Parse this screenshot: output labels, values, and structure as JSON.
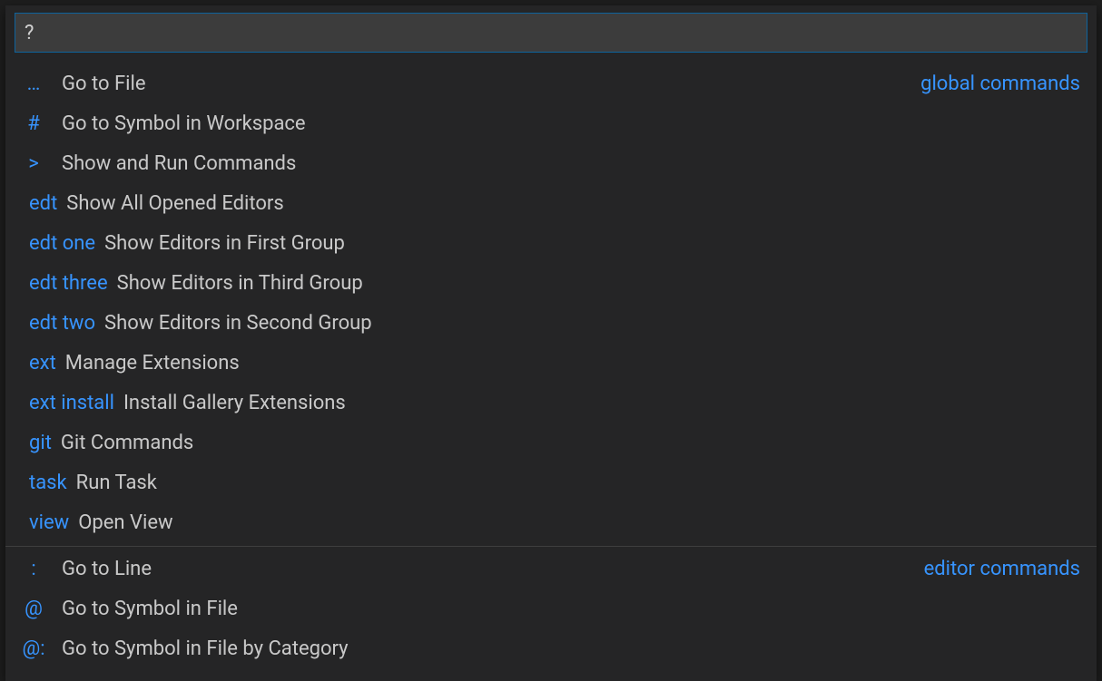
{
  "input": {
    "value": "?",
    "placeholder": ""
  },
  "groups": [
    {
      "badge": "global commands",
      "items": [
        {
          "prefix": "…",
          "short": true,
          "label": "Go to File"
        },
        {
          "prefix": "#",
          "short": true,
          "label": "Go to Symbol in Workspace"
        },
        {
          "prefix": ">",
          "short": true,
          "label": "Show and Run Commands"
        },
        {
          "prefix": "edt",
          "short": false,
          "label": "Show All Opened Editors"
        },
        {
          "prefix": "edt one",
          "short": false,
          "label": "Show Editors in First Group"
        },
        {
          "prefix": "edt three",
          "short": false,
          "label": "Show Editors in Third Group"
        },
        {
          "prefix": "edt two",
          "short": false,
          "label": "Show Editors in Second Group"
        },
        {
          "prefix": "ext",
          "short": false,
          "label": "Manage Extensions"
        },
        {
          "prefix": "ext install",
          "short": false,
          "label": "Install Gallery Extensions"
        },
        {
          "prefix": "git",
          "short": false,
          "label": "Git Commands"
        },
        {
          "prefix": "task",
          "short": false,
          "label": "Run Task"
        },
        {
          "prefix": "view",
          "short": false,
          "label": "Open View"
        }
      ]
    },
    {
      "badge": "editor commands",
      "items": [
        {
          "prefix": ":",
          "short": true,
          "label": "Go to Line"
        },
        {
          "prefix": "@",
          "short": true,
          "label": "Go to Symbol in File"
        },
        {
          "prefix": "@:",
          "short": true,
          "label": "Go to Symbol in File by Category"
        }
      ]
    }
  ]
}
